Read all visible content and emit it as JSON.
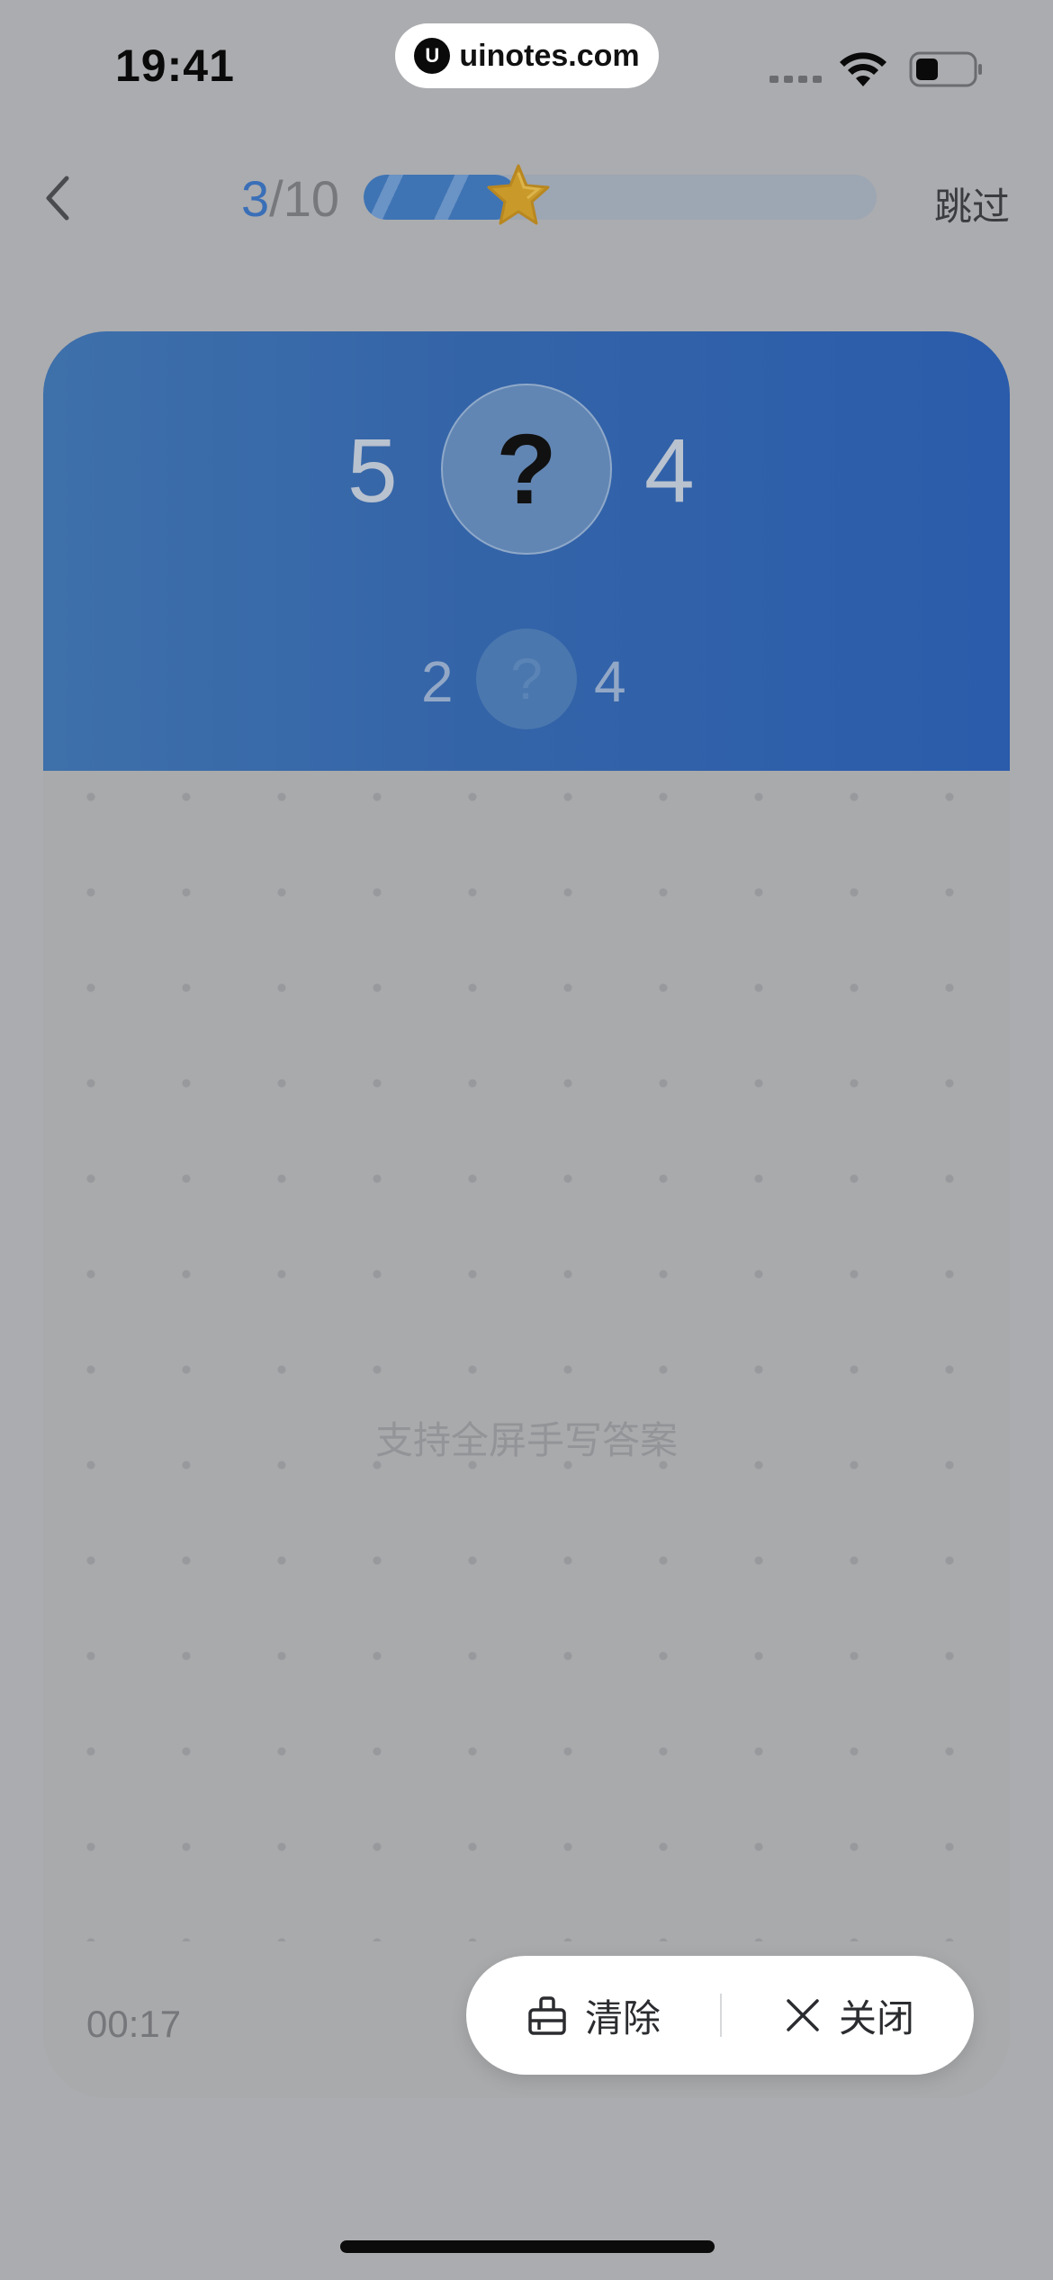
{
  "status_bar": {
    "time": "19:41",
    "url_logo": "U",
    "url": "uinotes.com"
  },
  "nav": {
    "progress_current": "3",
    "progress_total": "/10",
    "progress_fraction": 0.3,
    "skip_label": "跳过"
  },
  "question": {
    "main_left": "5",
    "main_mark": "?",
    "main_right": "4",
    "next_left": "2",
    "next_mark": "?",
    "next_right": "4"
  },
  "canvas": {
    "hint": "支持全屏手写答案",
    "timer": "00:17"
  },
  "actions": {
    "clear_label": "清除",
    "close_label": "关闭"
  },
  "colors": {
    "accent": "#3a6fb8",
    "header_blue": "#3464a8",
    "overlay": "#abacaf"
  }
}
